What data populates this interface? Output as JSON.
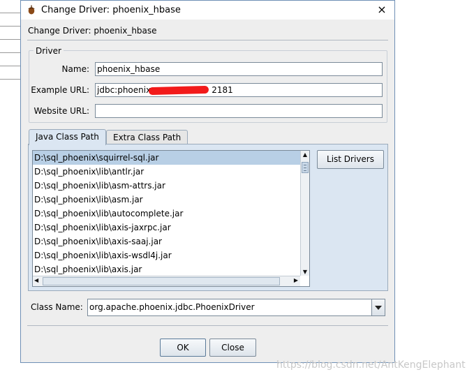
{
  "window": {
    "title": "Change Driver: phoenix_hbase",
    "header_label": "Change Driver: phoenix_hbase",
    "icon": "acorn-icon",
    "close_icon": "×"
  },
  "driver": {
    "legend": "Driver",
    "name_label": "Name:",
    "name_value": "phoenix_hbase",
    "example_url_label": "Example URL:",
    "example_url_prefix": "jdbc:phoenix:",
    "example_url_suffix": "2181",
    "website_url_label": "Website URL:",
    "website_url_value": ""
  },
  "tabs": [
    {
      "label": "Java Class Path",
      "active": true
    },
    {
      "label": "Extra Class Path",
      "active": false
    }
  ],
  "class_path": {
    "items": [
      "D:\\sql_phoenix\\squirrel-sql.jar",
      "D:\\sql_phoenix\\lib\\antlr.jar",
      "D:\\sql_phoenix\\lib\\asm-attrs.jar",
      "D:\\sql_phoenix\\lib\\asm.jar",
      "D:\\sql_phoenix\\lib\\autocomplete.jar",
      "D:\\sql_phoenix\\lib\\axis-jaxrpc.jar",
      "D:\\sql_phoenix\\lib\\axis-saaj.jar",
      "D:\\sql_phoenix\\lib\\axis-wsdl4j.jar",
      "D:\\sql_phoenix\\lib\\axis.jar"
    ],
    "selected_index": 0,
    "list_drivers_label": "List Drivers",
    "scroll_up": "▲",
    "scroll_down": "▼",
    "scroll_left": "◀",
    "scroll_right": "▶"
  },
  "class_name": {
    "label": "Class Name:",
    "value": "org.apache.phoenix.jdbc.PhoenixDriver"
  },
  "buttons": {
    "ok": "OK",
    "close": "Close"
  },
  "watermark": "https://blog.csdn.net/AntKengElephant",
  "colors": {
    "accent": "#dbe6f2",
    "selection": "#b8cfe5",
    "redaction": "#f21a1a"
  }
}
